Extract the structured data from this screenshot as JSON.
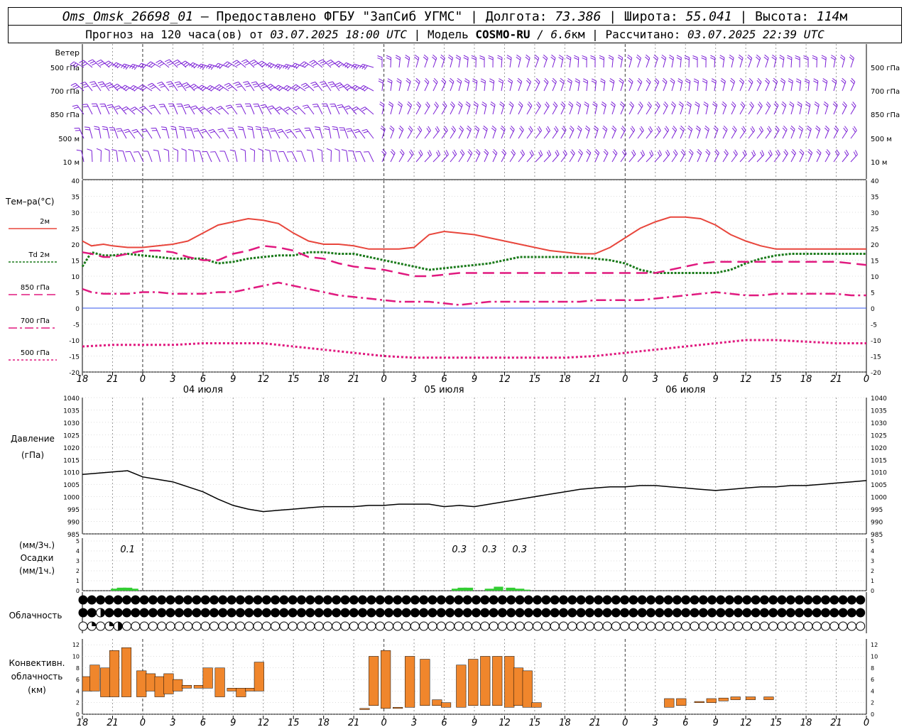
{
  "header": {
    "station": "Oms_Omsk_26698_01",
    "provided": "– Предоставлено ФГБУ \"ЗапСиб УГМС\"",
    "lon_label": "Долгота:",
    "lon": "73.386",
    "lat_label": "Широта:",
    "lat": "55.041",
    "alt_label": "Высота:",
    "alt": "114",
    "alt_unit": "м",
    "forecast_label": "Прогноз на 120 часа(ов) от",
    "forecast_from": "03.07.2025 18:00 UTC",
    "model_label": "Модель",
    "model": "COSMO-RU",
    "model_res": "/ 6.6",
    "model_res_unit": "км",
    "calc_label": "Рассчитано:",
    "calc_time": "03.07.2025 22:39 UTC"
  },
  "labels": {
    "wind": "Ветер",
    "wind_levels": [
      "500 гПа",
      "700 гПа",
      "850 гПа",
      "500 м",
      "10 м"
    ],
    "temp_title": "Тем–ра(°C)",
    "temp_legend": [
      "2м",
      "Td 2м",
      "850 гПа",
      "700 гПа",
      "500 гПа"
    ],
    "pressure": "Давление",
    "pressure_unit": "(гПа)",
    "precip_unit3": "(мм/3ч.)",
    "precip": "Осадки",
    "precip_unit1": "(мм/1ч.)",
    "cloud": "Облачность",
    "conv1": "Конвективн.",
    "conv2": "облачность",
    "conv3": "(км)"
  },
  "colors": {
    "t2m": "#e8463c",
    "td2m": "#1a7a1a",
    "t850": "#e0197f",
    "t700": "#e0197f",
    "t500": "#e0197f",
    "wind": "#7b1fd6",
    "precip": "#33cc33",
    "conv": "#f0862c",
    "zero": "#3355ee"
  },
  "chart_data": {
    "type": "line",
    "x_ticks": [
      "18",
      "21",
      "0",
      "3",
      "6",
      "9",
      "12",
      "15",
      "18",
      "21",
      "0",
      "3",
      "6",
      "9",
      "12",
      "15",
      "18",
      "21",
      "0",
      "3",
      "6",
      "9",
      "12",
      "15",
      "18",
      "21",
      "0"
    ],
    "day_labels": [
      {
        "at": 4,
        "text": "04 июля"
      },
      {
        "at": 12,
        "text": "05 июля"
      },
      {
        "at": 20,
        "text": "06 июля"
      }
    ],
    "temp_axis": {
      "min": -20,
      "max": 40,
      "ticks": [
        40,
        35,
        30,
        25,
        20,
        15,
        10,
        5,
        0,
        -5,
        -10,
        -15,
        -20
      ]
    },
    "temp_series": [
      {
        "name": "2м",
        "style": "solid",
        "x": [
          0,
          0.3,
          0.7,
          1,
          1.5,
          2,
          2.5,
          3,
          3.5,
          4,
          4.5,
          5,
          5.5,
          6,
          6.5,
          7,
          7.5,
          8,
          8.5,
          9,
          9.5,
          10,
          10.5,
          11,
          11.5,
          12,
          12.5,
          13,
          13.5,
          14,
          14.5,
          15,
          15.5,
          16,
          16.5,
          17,
          17.5,
          18,
          18.5,
          19,
          19.5,
          20,
          20.5,
          21,
          21.5,
          22,
          22.5,
          23,
          23.5,
          24,
          24.5,
          25,
          25.5,
          26
        ],
        "y": [
          21,
          19.5,
          20,
          19.5,
          19,
          19,
          19.5,
          20,
          21,
          23.5,
          26,
          27,
          28,
          27.5,
          26.5,
          23.5,
          21,
          20,
          20,
          19.5,
          18.5,
          18.5,
          18.5,
          19,
          23,
          24,
          23.5,
          23,
          22,
          21,
          20,
          19,
          18,
          17.5,
          17,
          17,
          19,
          22,
          25,
          27,
          28.5,
          28.5,
          28,
          26,
          23,
          21,
          19.5,
          18.5,
          18.5,
          18.5,
          18.5,
          18.5,
          18.5,
          18.5
        ]
      },
      {
        "name": "Td 2м",
        "style": "dotted-thick",
        "x": [
          0,
          0.3,
          0.7,
          1,
          1.5,
          2,
          2.5,
          3,
          3.5,
          4,
          4.5,
          5,
          5.5,
          6,
          6.5,
          7,
          7.5,
          8,
          8.5,
          9,
          9.5,
          10,
          10.5,
          11,
          11.5,
          12,
          12.5,
          13,
          13.5,
          14,
          14.5,
          15,
          15.5,
          16,
          16.5,
          17,
          17.5,
          18,
          18.5,
          19,
          19.5,
          20,
          20.5,
          21,
          21.5,
          22,
          22.5,
          23,
          23.5,
          24,
          24.5,
          25,
          25.5,
          26
        ],
        "y": [
          13,
          17.5,
          16.5,
          16.5,
          17,
          16.5,
          16,
          15.5,
          15.5,
          15.5,
          14,
          14.5,
          15.5,
          16,
          16.5,
          16.5,
          17.5,
          17.5,
          17,
          17,
          16,
          15,
          14,
          13,
          12,
          12.5,
          13,
          13.5,
          14,
          15,
          16,
          16,
          16,
          16,
          16,
          15.5,
          15,
          14,
          12,
          11,
          11,
          11,
          11,
          11,
          12,
          14,
          15.5,
          16.5,
          17,
          17,
          17,
          17,
          17,
          17
        ]
      },
      {
        "name": "850 гПа",
        "style": "dashed",
        "x": [
          0,
          0.3,
          0.7,
          1,
          1.5,
          2,
          2.5,
          3,
          3.5,
          4,
          4.5,
          5,
          5.5,
          6,
          6.5,
          7,
          7.5,
          8,
          8.5,
          9,
          9.5,
          10,
          10.5,
          11,
          11.5,
          12,
          12.5,
          13,
          13.5,
          14,
          14.5,
          15,
          15.5,
          16,
          16.5,
          17,
          17.5,
          18,
          18.5,
          19,
          19.5,
          20,
          20.5,
          21,
          21.5,
          22,
          22.5,
          23,
          23.5,
          24,
          24.5,
          25,
          25.5,
          26
        ],
        "y": [
          17.5,
          17,
          16,
          16,
          17,
          18,
          18,
          17.5,
          16,
          15,
          15,
          17,
          18,
          19.5,
          19,
          18,
          16,
          15.5,
          14,
          13,
          12.5,
          12,
          11,
          10,
          10,
          10.5,
          11,
          11,
          11,
          11,
          11,
          11,
          11,
          11,
          11,
          11,
          11,
          11,
          11,
          11,
          12,
          13,
          14,
          14.5,
          14.5,
          14.5,
          14.5,
          14.5,
          14.5,
          14.5,
          14.5,
          14.5,
          14,
          13.5
        ]
      },
      {
        "name": "700 гПа",
        "style": "dashdot",
        "x": [
          0,
          0.3,
          0.7,
          1,
          1.5,
          2,
          2.5,
          3,
          3.5,
          4,
          4.5,
          5,
          5.5,
          6,
          6.5,
          7,
          7.5,
          8,
          8.5,
          9,
          9.5,
          10,
          10.5,
          11,
          11.5,
          12,
          12.5,
          13,
          13.5,
          14,
          14.5,
          15,
          15.5,
          16,
          16.5,
          17,
          17.5,
          18,
          18.5,
          19,
          19.5,
          20,
          20.5,
          21,
          21.5,
          22,
          22.5,
          23,
          23.5,
          24,
          24.5,
          25,
          25.5,
          26
        ],
        "y": [
          6,
          5,
          4.5,
          4.5,
          4.5,
          5,
          5,
          4.5,
          4.5,
          4.5,
          5,
          5,
          6,
          7,
          8,
          7,
          6,
          5,
          4,
          3.5,
          3,
          2.5,
          2,
          2,
          2,
          1.5,
          1,
          1.5,
          2,
          2,
          2,
          2,
          2,
          2,
          2,
          2.5,
          2.5,
          2.5,
          2.5,
          3,
          3.5,
          4,
          4.5,
          5,
          4.5,
          4,
          4,
          4.5,
          4.5,
          4.5,
          4.5,
          4.5,
          4,
          4
        ]
      },
      {
        "name": "500 гПа",
        "style": "dotted",
        "x": [
          0,
          1,
          2,
          3,
          4,
          5,
          6,
          7,
          8,
          9,
          10,
          11,
          12,
          13,
          14,
          15,
          16,
          17,
          18,
          19,
          20,
          21,
          22,
          23,
          24,
          25,
          26
        ],
        "y": [
          -12,
          -11.5,
          -11.5,
          -11.5,
          -11,
          -11,
          -11,
          -12,
          -13,
          -14,
          -15,
          -15.5,
          -15.5,
          -15.5,
          -15.5,
          -15.5,
          -15.5,
          -15,
          -14,
          -13,
          -12,
          -11,
          -10,
          -10,
          -10.5,
          -11,
          -11
        ]
      }
    ],
    "pressure_axis": {
      "min": 985,
      "max": 1040,
      "ticks": [
        1040,
        1035,
        1030,
        1025,
        1020,
        1015,
        1010,
        1005,
        1000,
        995,
        990,
        985
      ]
    },
    "pressure_series": {
      "name": "Давление",
      "x": [
        0,
        0.5,
        1,
        1.5,
        2,
        2.5,
        3,
        3.5,
        4,
        4.5,
        5,
        5.5,
        6,
        6.5,
        7,
        7.5,
        8,
        8.5,
        9,
        9.5,
        10,
        10.5,
        11,
        11.5,
        12,
        12.5,
        13,
        13.5,
        14,
        14.5,
        15,
        15.5,
        16,
        16.5,
        17,
        17.5,
        18,
        18.5,
        19,
        19.5,
        20,
        20.5,
        21,
        21.5,
        22,
        22.5,
        23,
        23.5,
        24,
        24.5,
        25,
        25.5,
        26
      ],
      "y": [
        1009,
        1009.5,
        1010,
        1010.5,
        1008,
        1007,
        1006,
        1004,
        1002,
        999,
        996.5,
        995,
        994,
        994.5,
        995,
        995.5,
        996,
        996,
        996,
        996.5,
        996.5,
        997,
        997,
        997,
        996,
        996.5,
        996,
        997,
        998,
        999,
        1000,
        1001,
        1002,
        1003,
        1003.5,
        1004,
        1004,
        1004.5,
        1004.5,
        1004,
        1003.5,
        1003,
        1002.5,
        1003,
        1003.5,
        1004,
        1004,
        1004.5,
        1004.5,
        1005,
        1005.5,
        1006,
        1006.5
      ]
    },
    "precip_axis": {
      "min": 0,
      "max": 5,
      "ticks": [
        5,
        4,
        3,
        2,
        1,
        0
      ]
    },
    "precip_labels": [
      {
        "at": 1.5,
        "text": "0.1"
      },
      {
        "at": 12.5,
        "text": "0.3"
      },
      {
        "at": 13.5,
        "text": "0.3"
      },
      {
        "at": 14.5,
        "text": "0.3"
      }
    ],
    "precip_hourly": [
      {
        "x": 1.1,
        "v": 0.2
      },
      {
        "x": 1.3,
        "v": 0.3
      },
      {
        "x": 1.5,
        "v": 0.3
      },
      {
        "x": 1.7,
        "v": 0.2
      },
      {
        "x": 12.4,
        "v": 0.2
      },
      {
        "x": 12.6,
        "v": 0.3
      },
      {
        "x": 12.8,
        "v": 0.3
      },
      {
        "x": 13.5,
        "v": 0.2
      },
      {
        "x": 13.8,
        "v": 0.4
      },
      {
        "x": 14.2,
        "v": 0.3
      },
      {
        "x": 14.5,
        "v": 0.2
      },
      {
        "x": 14.7,
        "v": 0.1
      }
    ],
    "cloud_rows": [
      "FFFFFFFFFFFFFFFFFFFFFFFFFFFFFFFFFFFFFFFFFFFFFFFFFFFFFFFFFFFFFFFFFFFFFFFFFFFFFFFFFFFFFFFFFFFFFFFFFFFFFFFFFFFFFFFF",
      "FFHFFFFFFFFFFFFFFFFFFFFFFFFFFFFFFFFFFFFFFFFFFFFFFFFFFFFFFFFFFFFFFFFFFFFFFFFFFFFFFFFFFFFFFFFFFFFFFFFFFFFFFFFFFFFF",
      "EQEQHEEEEEEEEEEEEEEEEEEEEEEEEEEEEEEEEEEEEEEEEEEEEEEEEEEEEEEEEEEEEEEEEEEEEEEEEEEEEEEEEEEEEEEEEEEEEEEEEEEEEEEEEEE"
    ],
    "conv_axis": {
      "min": 0,
      "max": 13,
      "ticks": [
        12,
        10,
        8,
        6,
        4,
        2,
        0
      ]
    },
    "conv_bars": [
      [
        0,
        4,
        6.5
      ],
      [
        0.25,
        4,
        8.5
      ],
      [
        0.6,
        3,
        8
      ],
      [
        0.9,
        3,
        11
      ],
      [
        1.3,
        3,
        11.5
      ],
      [
        1.8,
        3,
        7.5
      ],
      [
        2.1,
        4,
        7
      ],
      [
        2.4,
        3,
        6.5
      ],
      [
        2.7,
        3.5,
        7
      ],
      [
        3.0,
        4,
        6
      ],
      [
        3.3,
        4.5,
        5
      ],
      [
        3.7,
        4.5,
        5
      ],
      [
        4.0,
        4.5,
        8
      ],
      [
        4.4,
        3,
        8
      ],
      [
        4.8,
        4,
        4.5
      ],
      [
        5.1,
        3,
        4.5
      ],
      [
        5.4,
        4,
        4.5
      ],
      [
        5.7,
        4,
        9
      ],
      [
        9.2,
        0.8,
        1
      ],
      [
        9.5,
        1.5,
        10
      ],
      [
        9.9,
        1,
        11
      ],
      [
        10.3,
        1,
        1.2
      ],
      [
        10.7,
        1.2,
        10
      ],
      [
        11.2,
        1.5,
        9.5
      ],
      [
        11.6,
        1.5,
        2.5
      ],
      [
        11.9,
        1.2,
        2
      ],
      [
        12.4,
        1.2,
        8.5
      ],
      [
        12.8,
        1.5,
        9.5
      ],
      [
        13.2,
        1.5,
        10
      ],
      [
        13.6,
        1.5,
        10
      ],
      [
        14.0,
        1.2,
        10
      ],
      [
        14.3,
        1.5,
        8
      ],
      [
        14.6,
        1.2,
        7.5
      ],
      [
        14.9,
        1.2,
        2
      ],
      [
        19.3,
        1.2,
        2.7
      ],
      [
        19.7,
        1.5,
        2.7
      ],
      [
        20.3,
        2,
        2.2
      ],
      [
        20.7,
        2,
        2.7
      ],
      [
        21.1,
        2.3,
        2.8
      ],
      [
        21.5,
        2.5,
        3
      ],
      [
        22.0,
        2.5,
        3
      ],
      [
        22.6,
        2.5,
        3
      ]
    ]
  }
}
